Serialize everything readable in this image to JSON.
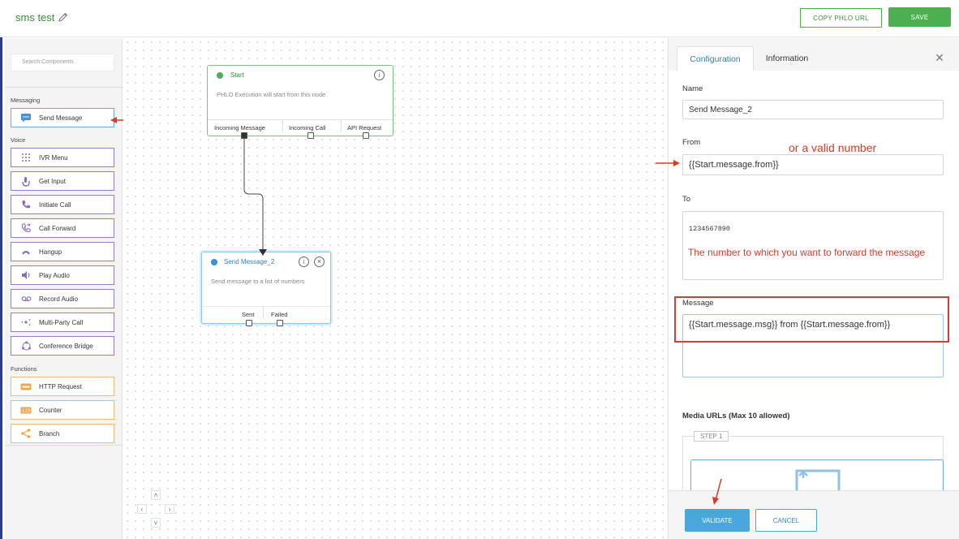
{
  "header": {
    "title": "sms test",
    "copy_url_label": "COPY PHLO URL",
    "save_label": "SAVE"
  },
  "sidebar": {
    "search_placeholder": "Search Components",
    "sections": [
      {
        "label": "Messaging",
        "items": [
          {
            "label": "Send Message",
            "icon": "chat-icon"
          }
        ]
      },
      {
        "label": "Voice",
        "items": [
          {
            "label": "IVR Menu",
            "icon": "keypad-icon"
          },
          {
            "label": "Get Input",
            "icon": "touch-icon"
          },
          {
            "label": "Initiate Call",
            "icon": "phone-icon"
          },
          {
            "label": "Call Forward",
            "icon": "phone-forward-icon"
          },
          {
            "label": "Hangup",
            "icon": "hangup-icon"
          },
          {
            "label": "Play Audio",
            "icon": "speaker-icon"
          },
          {
            "label": "Record Audio",
            "icon": "voicemail-icon"
          },
          {
            "label": "Multi-Party Call",
            "icon": "multiparty-icon"
          },
          {
            "label": "Conference Bridge",
            "icon": "conference-icon"
          }
        ]
      },
      {
        "label": "Functions",
        "items": [
          {
            "label": "HTTP Request",
            "icon": "http-icon"
          },
          {
            "label": "Counter",
            "icon": "counter-icon"
          },
          {
            "label": "Branch",
            "icon": "branch-icon"
          }
        ]
      }
    ]
  },
  "canvas": {
    "start_node": {
      "title": "Start",
      "description": "PHLO Execution will start from this node",
      "ports": [
        "Incoming Message",
        "Incoming Call",
        "API Request"
      ]
    },
    "send_node": {
      "title": "Send Message_2",
      "description": "Send message to a list of numbers",
      "ports": [
        "Sent",
        "Failed"
      ]
    }
  },
  "panel": {
    "tabs": [
      "Configuration",
      "Information"
    ],
    "active_tab": "Configuration",
    "fields": {
      "name_label": "Name",
      "name_value": "Send Message_2",
      "from_label": "From",
      "from_value": "{{Start.message.from}}",
      "to_label": "To",
      "to_value": "1234567890",
      "message_label": "Message",
      "message_value": "{{Start.message.msg}} from {{Start.message.from}}",
      "media_label": "Media URLs (Max 10 allowed)",
      "step_label": "STEP 1"
    },
    "validate_label": "VALIDATE",
    "cancel_label": "CANCEL"
  },
  "annotations": {
    "from_note": "or a valid number",
    "to_note": "The number to which you want to forward the message"
  },
  "colors": {
    "brand_green": "#4caf50",
    "accent_blue": "#48a7dd",
    "annotation_red": "#d63b2a"
  }
}
